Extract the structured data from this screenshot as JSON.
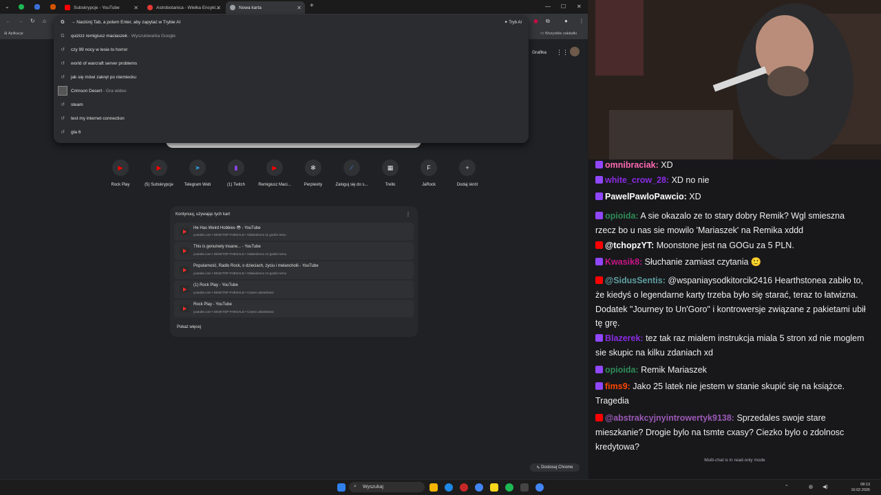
{
  "browser": {
    "tabs": [
      {
        "label": "Subskrypcje - YouTube",
        "favicon_color": "#ff0000"
      },
      {
        "label": "Astrobotanica - Wielka Encykl...",
        "favicon_color": "#e53935"
      },
      {
        "label": "Nowa karta",
        "favicon_color": "#9aa0a6"
      }
    ],
    "omnibox": {
      "text": "→ Naciśnij Tab, a potem Enter, aby zapytać w Trybie AI",
      "ai_mode_label": "Tryb AI",
      "suggestions": [
        {
          "text": "quizizz remigiusz maciaszek",
          "sub": " - Wyszukiwarka Google",
          "icon": "search-icon"
        },
        {
          "text": "czy 99 nocy w lesie to horror",
          "sub": "",
          "icon": "history-icon"
        },
        {
          "text": "world of warcraft server problems",
          "sub": "",
          "icon": "history-icon"
        },
        {
          "text": "jak się mówi zakręt po niemiecku",
          "sub": "",
          "icon": "history-icon"
        },
        {
          "text": "Crimson Desert",
          "sub": " - Gra wideo",
          "icon": "thumbnail"
        },
        {
          "text": "steam",
          "sub": "",
          "icon": "history-icon"
        },
        {
          "text": "test my internet connection",
          "sub": "",
          "icon": "history-icon"
        },
        {
          "text": "gta 6",
          "sub": "",
          "icon": "history-icon"
        }
      ]
    },
    "bookmarks": {
      "apps": "Aplikacje",
      "all": "Wszystkie zakładki"
    },
    "header_links": {
      "images": "Grafika"
    },
    "shortcuts": [
      {
        "label": "Rock Play",
        "glyph": "▶",
        "color": "#ff0000"
      },
      {
        "label": "(5) Subskrypcje",
        "glyph": "▶",
        "color": "#ff0000"
      },
      {
        "label": "Telegram Web",
        "glyph": "➤",
        "color": "#2aa3e0"
      },
      {
        "label": "(1) Twitch",
        "glyph": "▮",
        "color": "#9147ff"
      },
      {
        "label": "Remigiusz Maci...",
        "glyph": "▶",
        "color": "#ff0000"
      },
      {
        "label": "Perplexity",
        "glyph": "✻",
        "color": "#e3e3e3"
      },
      {
        "label": "Zaloguj się do s...",
        "glyph": "⁄",
        "color": "#4c8bf5"
      },
      {
        "label": "Trello",
        "glyph": "▦",
        "color": "#e3e3e3"
      },
      {
        "label": "JaRock",
        "glyph": "F",
        "color": "#e3e3e3"
      },
      {
        "label": "Dodaj skrót",
        "glyph": "+",
        "color": "#e3e3e3"
      }
    ],
    "resume": {
      "title": "Kontynuuj, używając tych kart",
      "items": [
        {
          "title": "He Has Weird Hobbies 😳 - YouTube",
          "meta": "youtube.com • DESKTOP-FHEGALD • Odwiedzono 11 godzin temu"
        },
        {
          "title": "This is genuinely insane... - YouTube",
          "meta": "youtube.com • DESKTOP-FHEGALD • Odwiedzono 12 godzin temu"
        },
        {
          "title": "Popularność, Radio Rock, o dzieciach, życiu i melancholii - YouTube",
          "meta": "youtube.com • DESKTOP-FHEGALD • Odwiedzono 12 godzin temu"
        },
        {
          "title": "(1) Rock Play - YouTube",
          "meta": "youtube.com • DESKTOP-FHEGALD • Często odwiedzasz"
        },
        {
          "title": "Rock Play - YouTube",
          "meta": "youtube.com • DESKTOP-FHEGALD • Często odwiedzasz"
        }
      ],
      "more": "Pokaż więcej"
    },
    "customize": "Dostosuj Chrome"
  },
  "chat": {
    "messages": [
      {
        "platform": "twitch",
        "user": "omnibraciak:",
        "user_color": "#ff69b4",
        "text": " XD"
      },
      {
        "platform": "twitch",
        "user": "white_crow_28:",
        "user_color": "#8a2be2",
        "text": " XD no nie"
      },
      {
        "platform": "twitch",
        "user": "PawelPawloPawcio:",
        "user_color": "#ffffff",
        "text": " XD"
      },
      {
        "platform": "twitch",
        "user": "opioida:",
        "user_color": "#2e8b57",
        "text": " A sie okazalo ze to stary dobry Remik? Wgl smieszna rzecz bo u nas sie mowilo 'Mariaszek' na Remika xddd"
      },
      {
        "platform": "youtube",
        "user": "@tchopzYT:",
        "user_color": "#ffffff",
        "text": " Moonstone jest na GOGu za 5 PLN."
      },
      {
        "platform": "twitch",
        "user": "Kwasik8:",
        "user_color": "#c71585",
        "text": " Słuchanie zamiast czytania 🙂"
      },
      {
        "platform": "youtube",
        "user": "@SidusSentis:",
        "user_color": "#5f9ea0",
        "text": " @wspaniaysodkitorcik2416 Hearthstonea zabiło to, że kiedyś o legendarne karty trzeba było się starać, teraz to łatwizna. Dodatek \"Journey to Un'Goro\" i kontrowersje związane z pakietami ubił tę grę."
      },
      {
        "platform": "twitch",
        "user": "Blazerek:",
        "user_color": "#8a2be2",
        "text": " tez tak raz mialem instrukcja miala 5 stron xd nie moglem sie skupic na kilku zdaniach xd"
      },
      {
        "platform": "twitch",
        "user": "opioida:",
        "user_color": "#2e8b57",
        "text": " Remik Mariaszek"
      },
      {
        "platform": "twitch",
        "user": "fims9:",
        "user_color": "#ff4500",
        "text": " Jako 25 latek nie jestem w stanie skupić się na książce. Tragedia"
      },
      {
        "platform": "youtube",
        "user": "@abstrakcyjnyintrowertyk9138:",
        "user_color": "#9b59b6",
        "text": " Sprzedales swoje stare mieszkanie? Drogie bylo na tsmte cxasy? Ciezko bylo o zdolnosc kredytowa?"
      }
    ],
    "readonly": "Multi-chat is in read-only mode"
  },
  "taskbar": {
    "search": "Wyszukaj",
    "time": "08:13",
    "date": "10.02.2026"
  }
}
